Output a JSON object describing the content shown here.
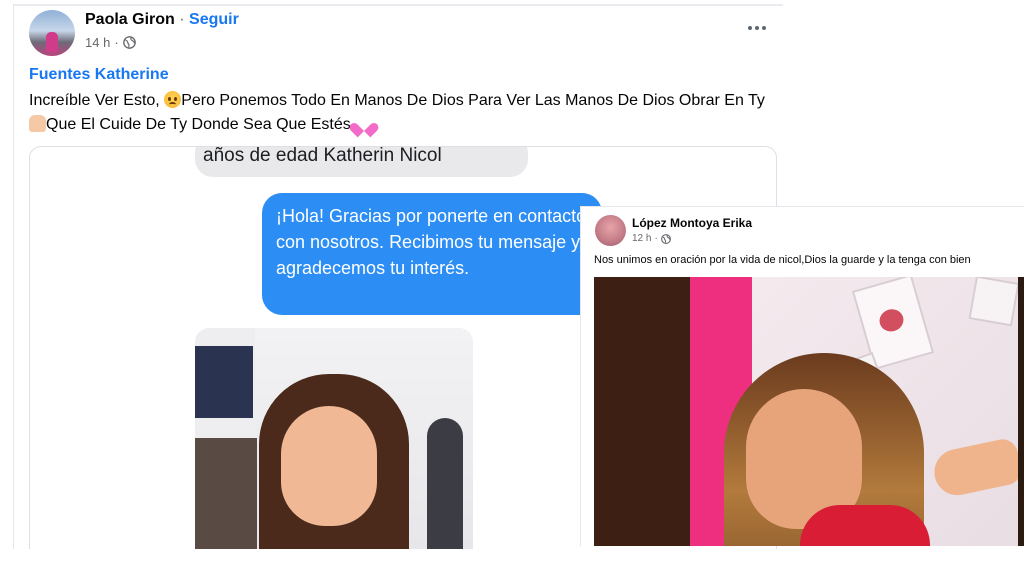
{
  "post": {
    "author": "Paola Giron",
    "separator": "·",
    "follow_label": "Seguir",
    "time": "14 h",
    "meta_dot": "·",
    "audience_icon": "globe-icon",
    "more_icon": "more-options-icon",
    "tagged_name": "Fuentes Katherine",
    "text_part1": "Increíble Ver Esto, ",
    "text_part2": "Pero Ponemos Todo En Manos De Dios Para Ver Las Manos De Dios Obrar En Ty ",
    "text_part3": "Que El Cuide De Ty Donde Sea Que Estés ",
    "emojis": [
      "sad-face-emoji",
      "praying-hands-emoji",
      "pink-heart-emoji"
    ]
  },
  "chat_screenshot": {
    "gray_bubble": "años de edad Katherin Nicol",
    "blue_bubble": "¡Hola! Gracias por ponerte en contacto con nosotros. Recibimos tu mensaje y agradecemos tu interés."
  },
  "overlay_post": {
    "author": "López Montoya Erika",
    "time": "12 h",
    "meta_dot": "·",
    "audience_icon": "globe-icon",
    "text": "Nos unimos en oración por la vida de nicol,Dios la guarde y la tenga con bien"
  },
  "colors": {
    "link_blue": "#1877f2",
    "messenger_blue": "#2c8ef5",
    "gray_bubble": "#e9e9eb",
    "text": "#050505",
    "secondary_text": "#65676b"
  }
}
